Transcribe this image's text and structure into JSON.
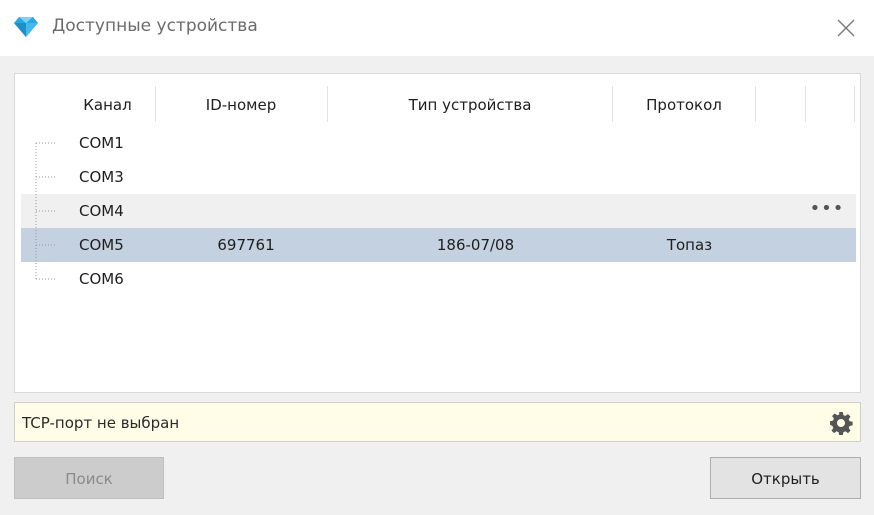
{
  "window": {
    "title": "Доступные устройства",
    "app_icon": "diamond-icon",
    "close_icon": "close-icon"
  },
  "columns": [
    "Канал",
    "ID-номер",
    "Тип устройства",
    "Протокол",
    "",
    ""
  ],
  "rows": [
    {
      "channel": "COM1",
      "id": "",
      "type": "",
      "protocol": ""
    },
    {
      "channel": "COM3",
      "id": "",
      "type": "",
      "protocol": ""
    },
    {
      "channel": "COM4",
      "id": "",
      "type": "",
      "protocol": "",
      "state": "hover",
      "more_label": "•••"
    },
    {
      "channel": "COM5",
      "id": "697761",
      "type": "186-07/08",
      "protocol": "Топаз",
      "state": "selected"
    },
    {
      "channel": "COM6",
      "id": "",
      "type": "",
      "protocol": ""
    }
  ],
  "status": {
    "text": "TCP-порт не выбран",
    "icon": "gear-icon"
  },
  "buttons": {
    "search": "Поиск",
    "open": "Открыть"
  },
  "colors": {
    "accent_icon": "#2aa7e3",
    "selected_row": "#c3d1e0",
    "hover_row": "#f0f0f0",
    "status_bg": "#fffde8"
  }
}
